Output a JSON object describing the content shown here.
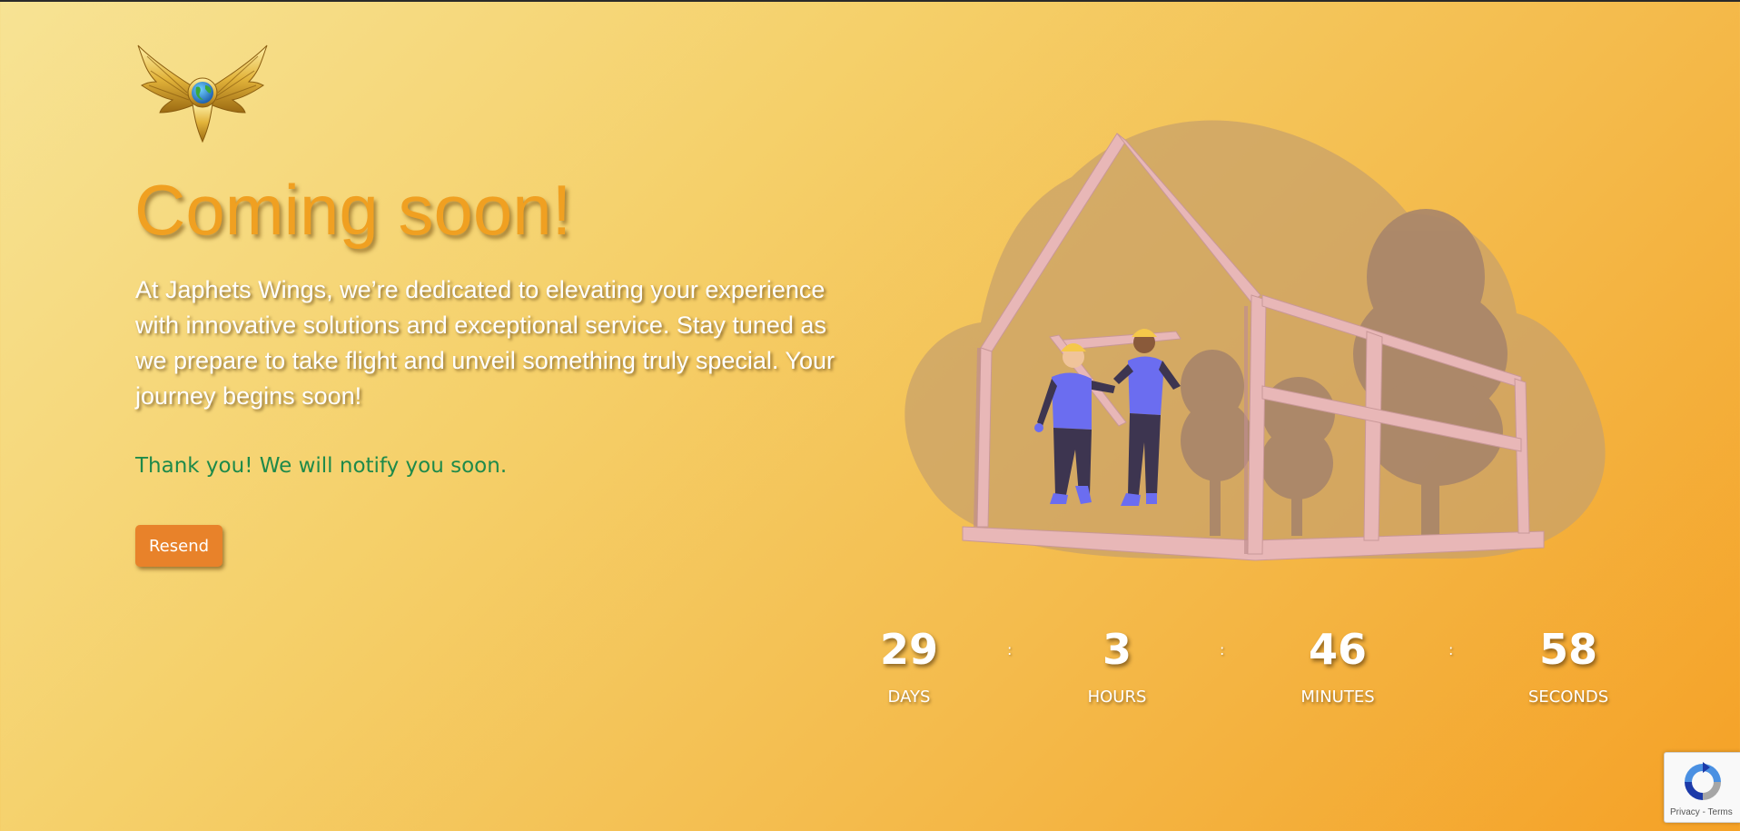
{
  "page": {
    "title": "Coming soon!",
    "description": "At Japhets Wings, we’re dedicated to elevating your experience with innovative solutions and exceptional service. Stay tuned as we prepare to take flight and unveil something truly special. Your journey begins soon!",
    "status_message": "Thank you! We will notify you soon.",
    "resend_label": "Resend"
  },
  "logo": {
    "icon": "winged-globe-logo"
  },
  "illustration": {
    "icon": "construction-workers-house-frame"
  },
  "countdown": {
    "units": [
      {
        "value": "29",
        "label": "DAYS"
      },
      {
        "value": "3",
        "label": "HOURS"
      },
      {
        "value": "46",
        "label": "MINUTES"
      },
      {
        "value": "58",
        "label": "SECONDS"
      }
    ],
    "separator": ":"
  },
  "recaptcha": {
    "privacy_label": "Privacy",
    "separator": " - ",
    "terms_label": "Terms"
  },
  "colors": {
    "title": "#f0a021",
    "status_message": "#1e8a4a",
    "button": "#e8822a",
    "background_start": "#f7e394",
    "background_end": "#f5a126"
  }
}
